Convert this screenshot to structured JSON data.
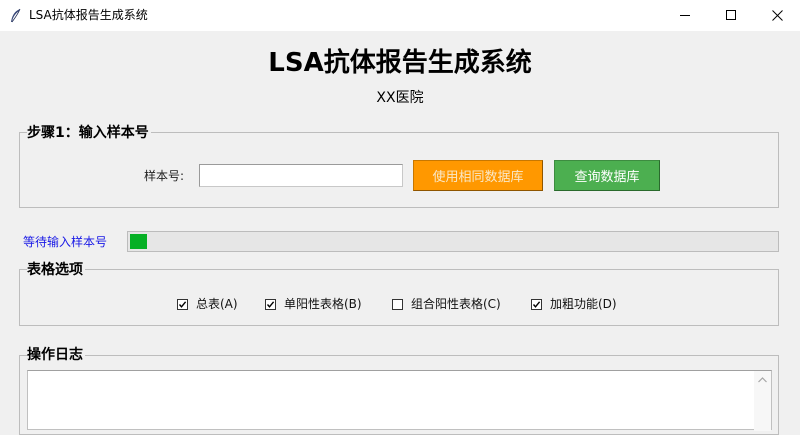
{
  "window": {
    "title": "LSA抗体报告生成系统"
  },
  "header": {
    "title": "LSA抗体报告生成系统",
    "subtitle": "XX医院"
  },
  "step1": {
    "group_label": "步骤1：输入样本号",
    "sample_label": "样本号:",
    "sample_value": "",
    "use_same_db_button": "使用相同数据库",
    "query_db_button": "查询数据库"
  },
  "status": {
    "text": "等待输入样本号",
    "progress_fraction": 0.027
  },
  "table_options": {
    "group_label": "表格选项",
    "checkboxes": [
      {
        "label": "总表(A)",
        "checked": true
      },
      {
        "label": "单阳性表格(B)",
        "checked": true
      },
      {
        "label": "组合阳性表格(C)",
        "checked": false
      },
      {
        "label": "加粗功能(D)",
        "checked": true
      }
    ]
  },
  "log": {
    "group_label": "操作日志",
    "content": ""
  },
  "colors": {
    "orange_button": "#ff9800",
    "green_button": "#4caf50",
    "progress_fill": "#06b025",
    "status_text": "#1a1ae6"
  }
}
